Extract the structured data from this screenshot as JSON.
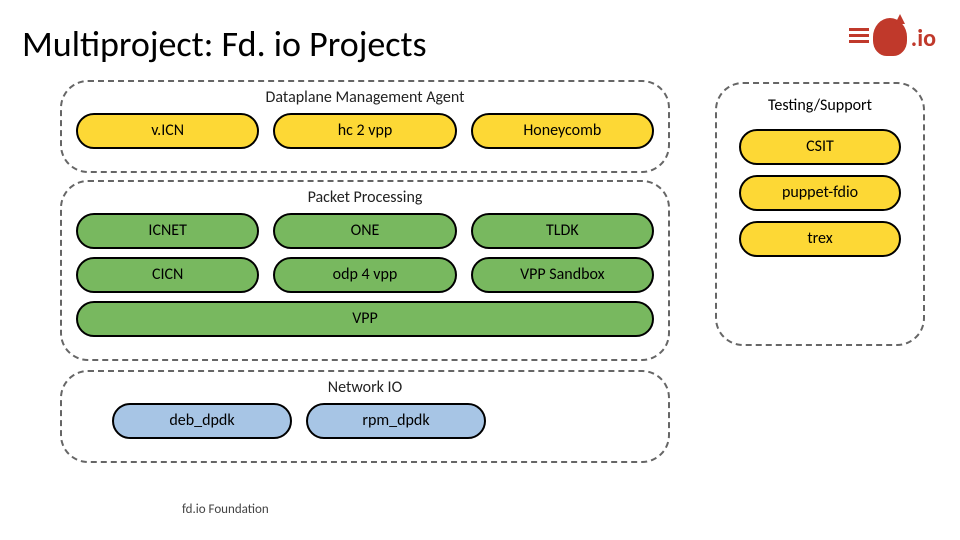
{
  "title": "Multiproject: Fd. io Projects",
  "logo_text": ".io",
  "footer": "fd.io Foundation",
  "groups": {
    "dma": {
      "title": "Dataplane Management Agent",
      "items": [
        "v.ICN",
        "hc 2 vpp",
        "Honeycomb"
      ]
    },
    "pp": {
      "title": "Packet Processing",
      "row1": [
        "ICNET",
        "ONE",
        "TLDK"
      ],
      "row2": [
        "CICN",
        "odp 4 vpp",
        "VPP Sandbox"
      ],
      "vpp": "VPP"
    },
    "nio": {
      "title": "Network IO",
      "items": [
        "deb_dpdk",
        "rpm_dpdk"
      ]
    },
    "ts": {
      "title": "Testing/Support",
      "items": [
        "CSIT",
        "puppet-fdio",
        "trex"
      ]
    }
  }
}
